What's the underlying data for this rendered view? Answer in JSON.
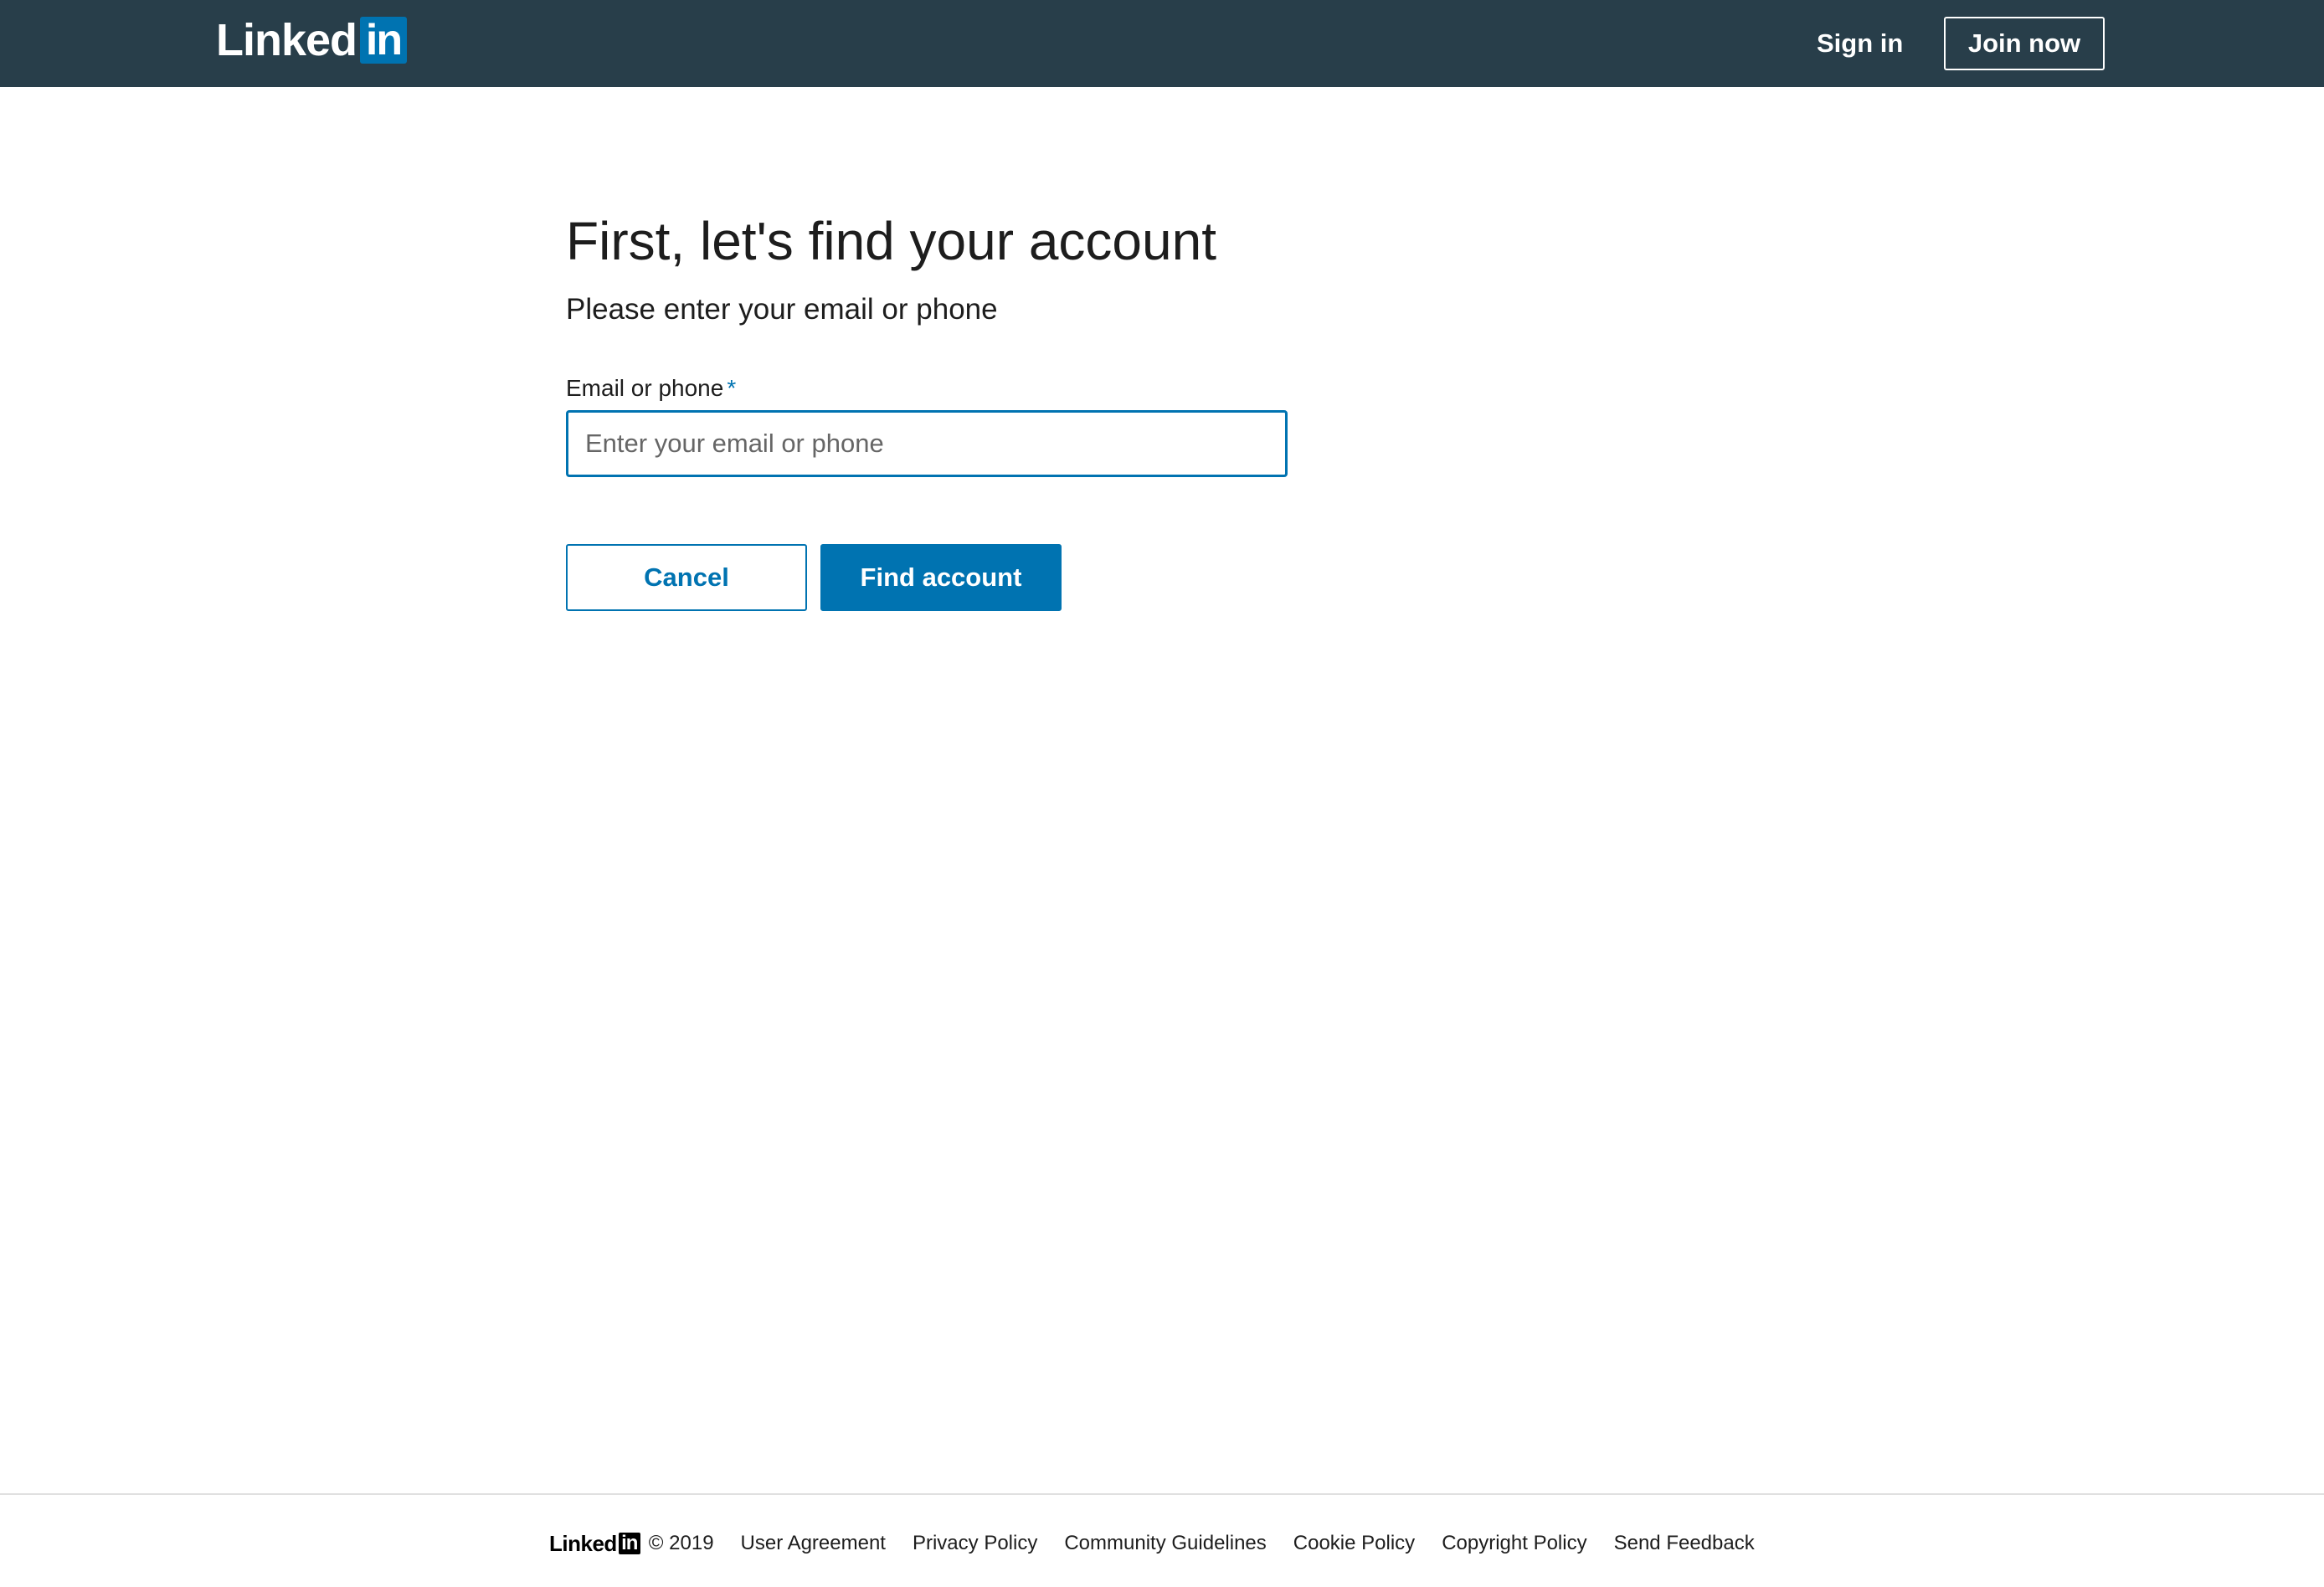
{
  "header": {
    "logo_word": "Linked",
    "logo_box": "in",
    "signin_label": "Sign in",
    "joinnow_label": "Join now"
  },
  "main": {
    "title": "First, let's find your account",
    "subtitle": "Please enter your email or phone",
    "field_label": "Email or phone",
    "required_mark": "*",
    "input_value": "",
    "input_placeholder": "Enter your email or phone",
    "cancel_label": "Cancel",
    "find_label": "Find account"
  },
  "footer": {
    "logo_word": "Linked",
    "logo_box": "in",
    "copyright": "© 2019",
    "links": [
      "User Agreement",
      "Privacy Policy",
      "Community Guidelines",
      "Cookie Policy",
      "Copyright Policy",
      "Send Feedback"
    ]
  },
  "colors": {
    "header_bg": "#283e4a",
    "brand_blue": "#0073b1",
    "text": "#1d1d1d"
  }
}
